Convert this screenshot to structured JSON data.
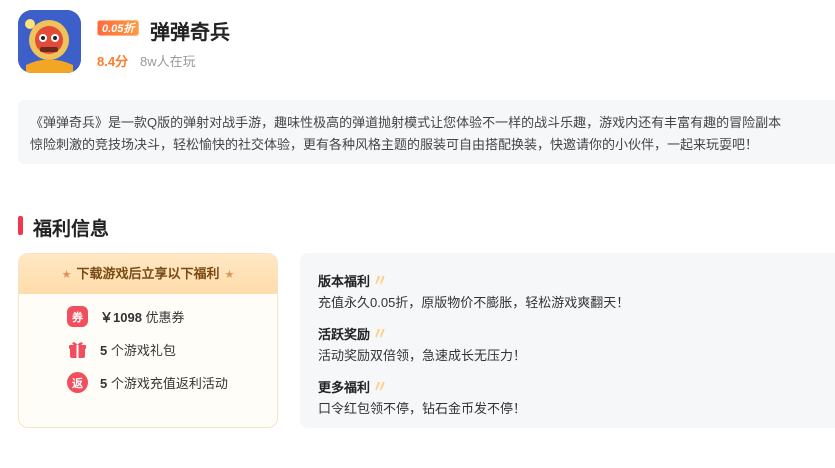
{
  "game": {
    "title": "弹弹奇兵",
    "discount": "0.05折",
    "score": "8.4分",
    "players": "8w人在玩",
    "description": "《弹弹奇兵》是一款Q版的弹射对战手游，趣味性极高的弹道抛射模式让您体验不一样的战斗乐趣，游戏内还有丰富有趣的冒险副本\n惊险刺激的竞技场决斗，轻松愉快的社交体验，更有各种风格主题的服装可自由搭配换装，快邀请你的小伙伴，一起来玩耍吧！"
  },
  "section": {
    "title": "福利信息"
  },
  "perk_card": {
    "header": "下载游戏后立享以下福利",
    "items": [
      {
        "icon": "coupon-icon",
        "icon_text": "券",
        "amount": "￥1098",
        "label": "优惠券"
      },
      {
        "icon": "gift-icon",
        "icon_text": "",
        "amount": "5",
        "label": "个游戏礼包"
      },
      {
        "icon": "rebate-icon",
        "icon_text": "返",
        "amount": "5",
        "label": "个游戏充值返利活动"
      }
    ]
  },
  "benefits": [
    {
      "title": "版本福利",
      "text": "充值永久0.05折，原版物价不膨胀，轻松游戏爽翻天！"
    },
    {
      "title": "活跃奖励",
      "text": "活动奖励双倍领，急速成长无压力！"
    },
    {
      "title": "更多福利",
      "text": "口令红包领不停，钻石金币发不停！"
    }
  ],
  "colors": {
    "accent": "#f1374c",
    "score": "#ff7a2a",
    "card_header": "#ffdcaa"
  }
}
